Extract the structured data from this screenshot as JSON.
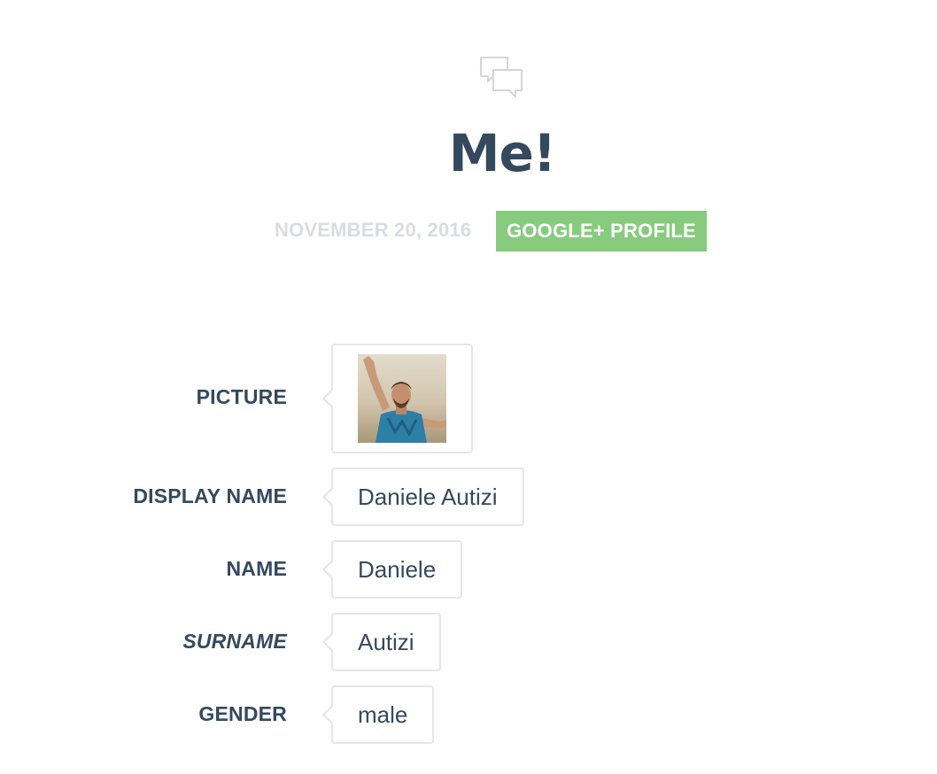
{
  "header": {
    "icon": "chat-bubbles-icon",
    "title": "Me!",
    "date": "NOVEMBER 20, 2016",
    "category_badge": "GOOGLE+ PROFILE",
    "badge_color": "#87cb7f"
  },
  "profile": {
    "picture": {
      "label": "PICTURE",
      "image": "avatar-photo"
    },
    "display_name": {
      "label": "DISPLAY NAME",
      "value": "Daniele Autizi"
    },
    "name": {
      "label": "NAME",
      "value": "Daniele"
    },
    "surname": {
      "label": "SURNAME",
      "value": "Autizi"
    },
    "gender": {
      "label": "GENDER",
      "value": "male"
    }
  },
  "colors": {
    "text": "#34495e",
    "muted": "#d9dde0",
    "bubble_border": "#e6e6e6"
  }
}
